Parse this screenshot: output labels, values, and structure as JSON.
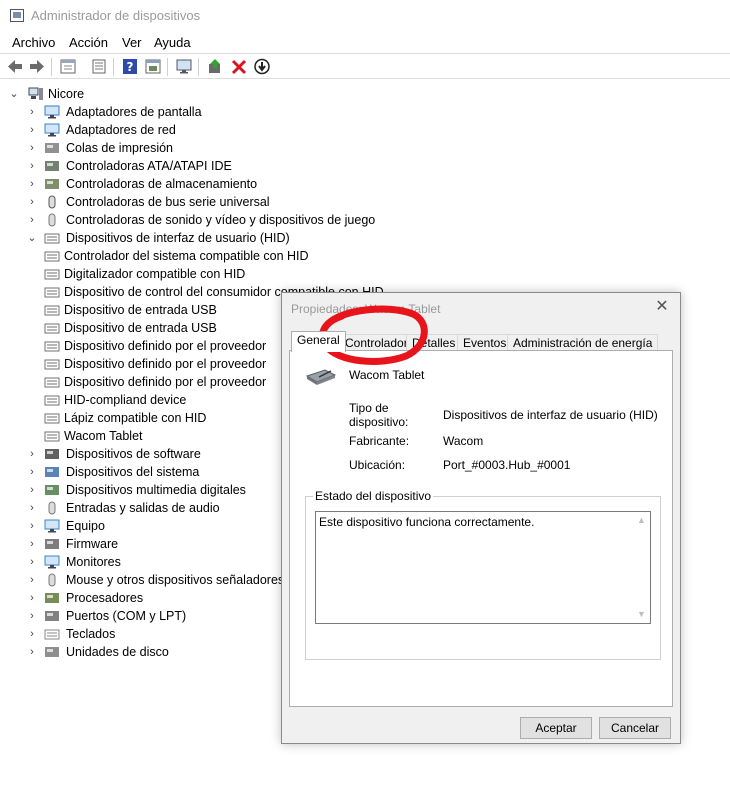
{
  "window": {
    "title": "Administrador de dispositivos"
  },
  "menu": [
    "Archivo",
    "Acción",
    "Ver",
    "Ayuda"
  ],
  "toolbar": [
    "back-icon",
    "forward-icon",
    "properties-view-icon",
    "list-icon",
    "help-icon",
    "view-icon",
    "monitor-icon",
    "update-driver-icon",
    "uninstall-icon",
    "download-icon"
  ],
  "tree": {
    "root": "Nicore",
    "items": [
      {
        "label": "Adaptadores de pantalla",
        "icon": "display-adapter-icon",
        "state": "collapsed"
      },
      {
        "label": "Adaptadores de red",
        "icon": "network-adapter-icon",
        "state": "collapsed"
      },
      {
        "label": "Colas de impresión",
        "icon": "print-queue-icon",
        "state": "collapsed"
      },
      {
        "label": "Controladoras ATA/ATAPI IDE",
        "icon": "ide-controller-icon",
        "state": "collapsed"
      },
      {
        "label": "Controladoras de almacenamiento",
        "icon": "storage-controller-icon",
        "state": "collapsed"
      },
      {
        "label": "Controladoras de bus serie universal",
        "icon": "usb-icon",
        "state": "collapsed"
      },
      {
        "label": "Controladoras de sonido y vídeo y dispositivos de juego",
        "icon": "sound-icon",
        "state": "collapsed"
      },
      {
        "label": "Dispositivos de interfaz de usuario (HID)",
        "icon": "hid-icon",
        "state": "expanded"
      },
      {
        "label": "Controlador del sistema compatible con HID",
        "icon": "hid-device-icon",
        "child": true
      },
      {
        "label": "Digitalizador compatible con HID",
        "icon": "hid-device-icon",
        "child": true
      },
      {
        "label": "Dispositivo de control del consumidor compatible con HID",
        "icon": "hid-device-icon",
        "child": true
      },
      {
        "label": "Dispositivo de entrada USB",
        "icon": "hid-device-icon",
        "child": true
      },
      {
        "label": "Dispositivo de entrada USB",
        "icon": "hid-device-icon",
        "child": true
      },
      {
        "label": "Dispositivo definido por el proveedor",
        "icon": "hid-device-icon",
        "child": true
      },
      {
        "label": "Dispositivo definido por el proveedor",
        "icon": "hid-device-icon",
        "child": true
      },
      {
        "label": "Dispositivo definido por el proveedor",
        "icon": "hid-device-icon",
        "child": true
      },
      {
        "label": "HID-compliand device",
        "icon": "hid-device-icon",
        "child": true
      },
      {
        "label": "Lápiz compatible con HID",
        "icon": "hid-device-icon",
        "child": true
      },
      {
        "label": "Wacom Tablet",
        "icon": "hid-device-icon",
        "child": true
      },
      {
        "label": "Dispositivos de software",
        "icon": "software-device-icon",
        "state": "collapsed"
      },
      {
        "label": "Dispositivos del sistema",
        "icon": "system-device-icon",
        "state": "collapsed"
      },
      {
        "label": "Dispositivos multimedia digitales",
        "icon": "multimedia-icon",
        "state": "collapsed"
      },
      {
        "label": "Entradas y salidas de audio",
        "icon": "audio-io-icon",
        "state": "collapsed"
      },
      {
        "label": "Equipo",
        "icon": "computer-icon",
        "state": "collapsed"
      },
      {
        "label": "Firmware",
        "icon": "firmware-icon",
        "state": "collapsed"
      },
      {
        "label": "Monitores",
        "icon": "monitor-icon",
        "state": "collapsed"
      },
      {
        "label": "Mouse y otros dispositivos señaladores",
        "icon": "mouse-icon",
        "state": "collapsed"
      },
      {
        "label": "Procesadores",
        "icon": "processor-icon",
        "state": "collapsed"
      },
      {
        "label": "Puertos (COM y LPT)",
        "icon": "port-icon",
        "state": "collapsed"
      },
      {
        "label": "Teclados",
        "icon": "keyboard-icon",
        "state": "collapsed"
      },
      {
        "label": "Unidades de disco",
        "icon": "disk-drive-icon",
        "state": "collapsed"
      }
    ]
  },
  "dialog": {
    "title": "Propiedades: Wacom Tablet",
    "tabs": [
      "General",
      "Controlador",
      "Detalles",
      "Eventos",
      "Administración de energía"
    ],
    "active_tab": "General",
    "device_name": "Wacom Tablet",
    "props": [
      {
        "key": "Tipo de\ndispositivo:",
        "value": "Dispositivos de interfaz de usuario (HID)"
      },
      {
        "key": "Fabricante:",
        "value": "Wacom"
      },
      {
        "key": "Ubicación:",
        "value": "Port_#0003.Hub_#0001"
      }
    ],
    "status_legend": "Estado del dispositivo",
    "status_text": "Este dispositivo funciona correctamente.",
    "ok_label": "Aceptar",
    "cancel_label": "Cancelar"
  },
  "colors": {
    "annotation": "#e8141b",
    "titlebar_text": "#999999"
  }
}
